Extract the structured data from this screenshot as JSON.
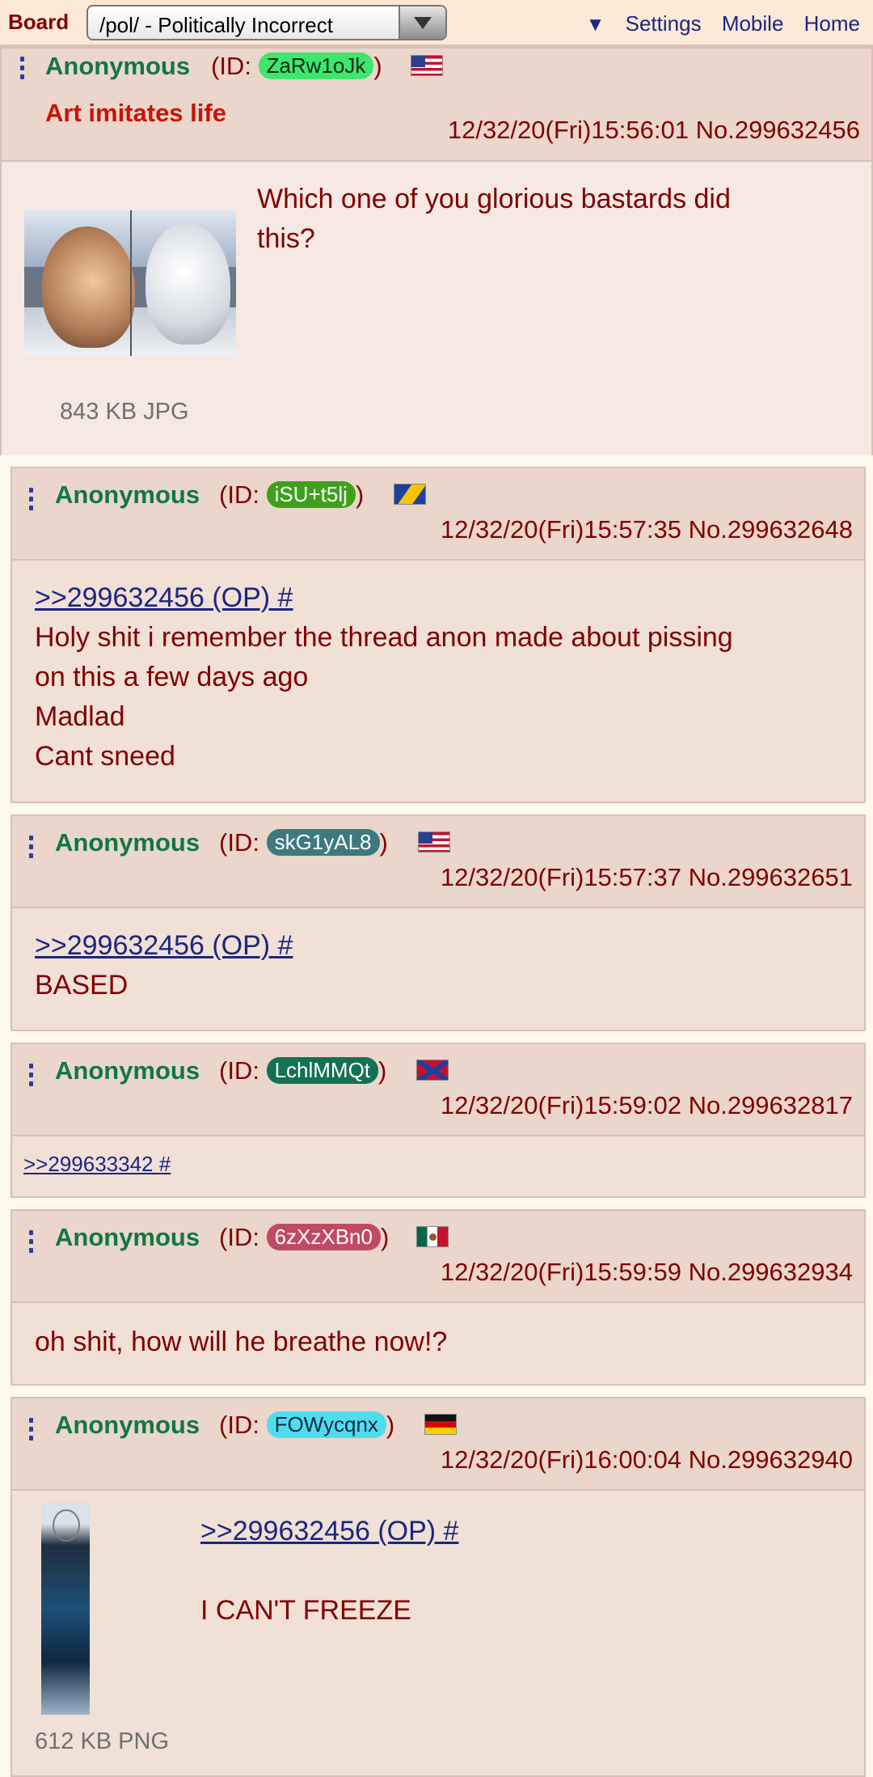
{
  "topbar": {
    "board_label": "Board",
    "board_select_value": "/pol/ - Politically Incorrect",
    "nav_arrow": "▼",
    "settings_label": "Settings",
    "mobile_label": "Mobile",
    "home_label": "Home"
  },
  "op": {
    "name": "Anonymous",
    "id_prefix": "(ID: ",
    "id": "ZaRw1oJk",
    "id_suffix": ")",
    "id_color": "#3fe66d",
    "id_text_color": "#0a2a12",
    "flag": "us",
    "subject": "Art imitates life",
    "datetime": "12/32/20(Fri)15:56:01 No.299632456",
    "text_line1": "Which one of you glorious bastards did",
    "text_line2": "this?",
    "file_info": "843 KB JPG"
  },
  "posts": [
    {
      "name": "Anonymous",
      "id_prefix": "(ID: ",
      "id": "iSU+t5lj",
      "id_suffix": ")",
      "id_color": "#3fa01e",
      "flag": "ba",
      "datetime": "12/32/20(Fri)15:57:35 No.299632648",
      "quote": ">>299632456 (OP) #",
      "line1": "Holy shit i remember the thread anon made about pissing",
      "line2": "on this a few days ago",
      "line3": "Madlad",
      "line4": "Cant sneed"
    },
    {
      "name": "Anonymous",
      "id_prefix": "(ID: ",
      "id": "skG1yAL8",
      "id_suffix": ")",
      "id_color": "#3d7a80",
      "flag": "us",
      "datetime": "12/32/20(Fri)15:57:37 No.299632651",
      "quote": ">>299632456 (OP) #",
      "line1": "BASED"
    },
    {
      "name": "Anonymous",
      "id_prefix": "(ID: ",
      "id": "LchlMMQt",
      "id_suffix": ")",
      "id_color": "#137154",
      "flag": "cs",
      "datetime": "12/32/20(Fri)15:59:02 No.299632817",
      "quote": ">>299633342 #"
    },
    {
      "name": "Anonymous",
      "id_prefix": "(ID: ",
      "id": "6zXzXBn0",
      "id_suffix": ")",
      "id_color": "#c14a63",
      "flag": "mx",
      "datetime": "12/32/20(Fri)15:59:59 No.299632934",
      "line1": "oh shit, how will he breathe now!?"
    },
    {
      "name": "Anonymous",
      "id_prefix": "(ID: ",
      "id": "FOWycqnx",
      "id_suffix": ")",
      "id_color": "#4fdcef",
      "id_text_color": "#0a2a40",
      "flag": "de",
      "datetime": "12/32/20(Fri)16:00:04 No.299632940",
      "quote": ">>299632456 (OP) #",
      "line1": "I CAN'T FREEZE",
      "file_info": "612 KB PNG"
    }
  ]
}
